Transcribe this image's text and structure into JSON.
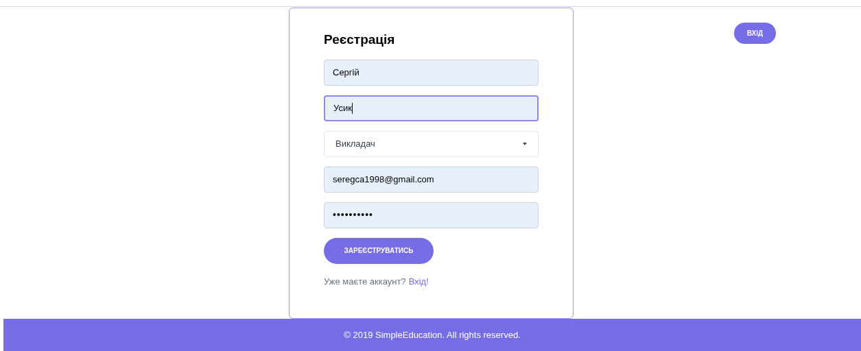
{
  "header": {
    "login_button": "ВХІД"
  },
  "form": {
    "title": "Реєстрація",
    "fields": [
      {
        "kind": "text",
        "value": "Сергій",
        "focused": false
      },
      {
        "kind": "text",
        "value": "Усик",
        "focused": true
      },
      {
        "kind": "select",
        "value": "Викладач",
        "focused": false
      },
      {
        "kind": "text",
        "value": "seregca1998@gmail.com",
        "focused": false
      },
      {
        "kind": "password",
        "value": "••••••••••",
        "focused": false
      }
    ],
    "submit_button": "ЗАРЕЄСТРУВАТИСЬ",
    "login_prompt": "Уже маєте аккаунт?",
    "login_link": "Вхід!"
  },
  "footer": {
    "text": "© 2019 SimpleEducation. All rights reserved."
  }
}
